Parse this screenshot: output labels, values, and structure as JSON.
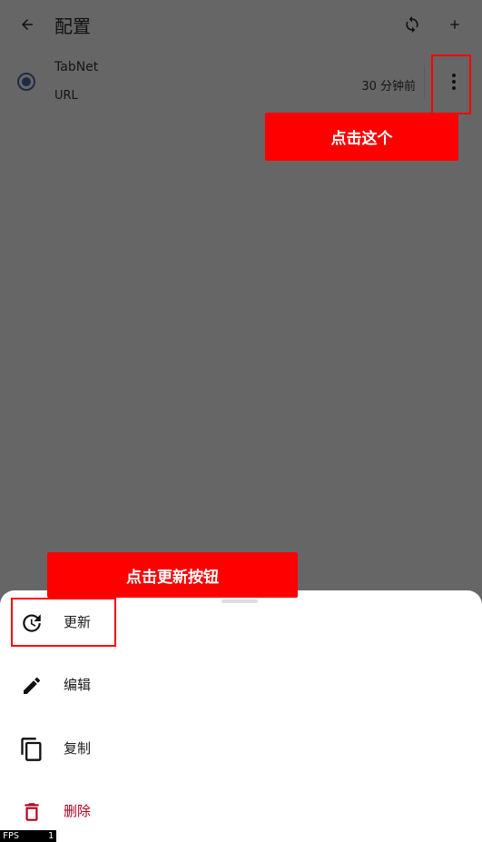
{
  "topbar": {
    "title": "配置",
    "back_icon": "arrow-back-icon",
    "sync_icon": "sync-icon",
    "add_icon": "plus-icon"
  },
  "profile": {
    "name": "TabNet",
    "type": "URL",
    "updated": "30 分钟前",
    "selected": true,
    "more_icon": "more-vert-icon"
  },
  "annotations": {
    "click_this": "点击这个",
    "click_update": "点击更新按钮",
    "highlight_color": "#ff0000"
  },
  "menu": {
    "items": [
      {
        "label": "更新",
        "icon": "update-icon"
      },
      {
        "label": "编辑",
        "icon": "edit-pencil-icon"
      },
      {
        "label": "复制",
        "icon": "copy-icon"
      },
      {
        "label": "删除",
        "icon": "delete-trash-icon",
        "color": "#b0001e"
      }
    ]
  },
  "fps": {
    "label": "FPS",
    "value": "1"
  }
}
